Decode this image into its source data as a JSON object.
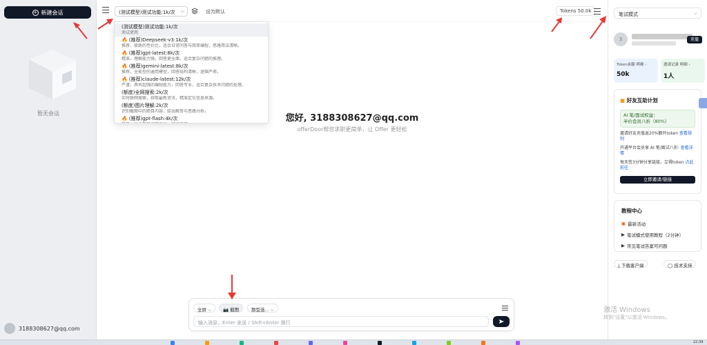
{
  "left": {
    "new_chat": "新建会话",
    "empty_text": "暂无会话",
    "user_email": "3188308627@qq.com"
  },
  "topbar": {
    "model_selected": "(测试模型)测试功能:1k/次",
    "set_default": "设为默认",
    "tokens": "Tokens 50.0k"
  },
  "dropdown": {
    "items": [
      {
        "title": "(测试模型)测试功能:1k/次",
        "desc": "测试使用",
        "fire": false
      },
      {
        "title": "(推荐)Deepseek-v3:1k/次",
        "desc": "推荐，极致的性价比，适合日常问答与简单编程，思路简洁清晰。",
        "fire": true
      },
      {
        "title": "(推荐)gpt-latest:8k/次",
        "desc": "精准，理解能力强，回答更全面，适合复杂问题的推理。",
        "fire": true
      },
      {
        "title": "(推荐)gemini-latest:8k/次",
        "desc": "推荐，全能型的通用模型，回答结构清晰，逻辑严密。",
        "fire": true
      },
      {
        "title": "(推荐)claude-latest:12k/次",
        "desc": "严谨，具有超强的编程能力，回答专业，适合复杂技术问题的处理。",
        "fire": true
      },
      {
        "title": "(额度)全网搜索:2k/次",
        "desc": "实时联网搜索，获取最新资讯，精准定位信息来源。",
        "fire": false
      },
      {
        "title": "(额度)图片理解:2k/次",
        "desc": "识别截图中的题目内容，给出解答与思路分析。",
        "fire": false
      },
      {
        "title": "(推荐)gpt-flash:4k/次",
        "desc": "快速，适合简单问答场景，响应迅速。",
        "fire": true
      }
    ]
  },
  "main": {
    "greeting": "您好, 3188308627@qq.com",
    "subtitle": "offerDoor帮您求职更简单，让 Offer 更轻松"
  },
  "composer": {
    "chip_fullscreen": "全屏 ⌵",
    "chip_screenshot": "截图",
    "chip_extra": "题型选... ⌵",
    "input_placeholder": "输入消息，Enter 发送 / Shift+Enter 换行"
  },
  "right": {
    "mode": "笔试模式",
    "avatar_letter": "3",
    "recharge": "充值",
    "stat1_label": "Token余额 明细 ›",
    "stat1_value": "50k",
    "stat2_label": "邀请记录 明细 ›",
    "stat2_value": "1人",
    "invite_title": "好友互助计划",
    "invite_reward_1": "AI 笔/面试权益：",
    "invite_reward_2": "半价会员八折（80%）",
    "invite_line1": "邀请好友充值返20%额外token",
    "invite_line1_link": "查看规则",
    "invite_line2": "开通平台会员享 AI 笔/面试八折:",
    "invite_line2_link": "查看详情",
    "invite_line3": "每天签3分钟分享链接，立得token",
    "invite_line3_link": "点此前往",
    "invite_btn": "立即邀请/链接",
    "docs_title": "教程中心",
    "doc1": "最新活动",
    "doc2": "笔试模式使用教程（2分钟）",
    "doc3": "常见笔试答案可问题",
    "btn_download": "下载客户端",
    "btn_support": "技术支持"
  },
  "watermark": {
    "line1": "激活 Windows",
    "line2": "转到\"设置\"以激活 Windows。"
  },
  "taskbar": {
    "time": "22:39"
  },
  "colors": {
    "accent_dark": "#111827",
    "annotation_red": "#e53935",
    "link_blue": "#1d64d8"
  }
}
